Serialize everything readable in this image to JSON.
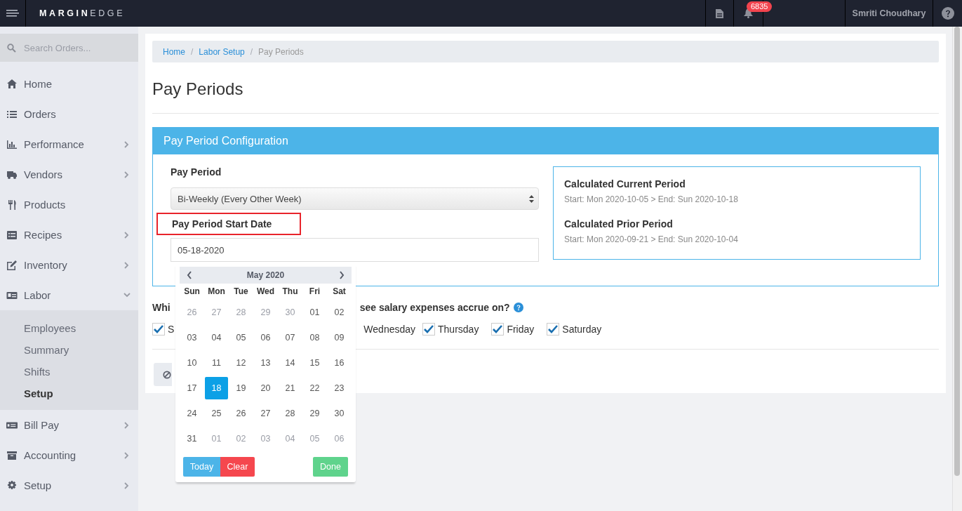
{
  "topbar": {
    "logo_strong": "MARGIN",
    "logo_light": "EDGE",
    "notification_count": "6835",
    "user": "Smriti Choudhary"
  },
  "sidebar": {
    "search": {
      "placeholder": "Search Orders..."
    },
    "items": [
      {
        "kind": "home",
        "label": "Home",
        "arrow": false
      },
      {
        "kind": "list",
        "label": "Orders",
        "arrow": false
      },
      {
        "kind": "chart",
        "label": "Performance",
        "arrow": true
      },
      {
        "kind": "truck",
        "label": "Vendors",
        "arrow": true
      },
      {
        "kind": "utensils",
        "label": "Products",
        "arrow": false
      },
      {
        "kind": "book",
        "label": "Recipes",
        "arrow": true
      },
      {
        "kind": "edit",
        "label": "Inventory",
        "arrow": true
      },
      {
        "kind": "card",
        "label": "Labor",
        "arrow": true,
        "expanded": true,
        "children": [
          {
            "label": "Employees",
            "selected": false
          },
          {
            "label": "Summary",
            "selected": false
          },
          {
            "label": "Shifts",
            "selected": false
          },
          {
            "label": "Setup",
            "selected": true
          }
        ]
      },
      {
        "kind": "bill",
        "label": "Bill Pay",
        "arrow": true
      },
      {
        "kind": "archive",
        "label": "Accounting",
        "arrow": true
      },
      {
        "kind": "gear",
        "label": "Setup",
        "arrow": true
      }
    ]
  },
  "breadcrumb": [
    {
      "label": "Home",
      "link": true
    },
    {
      "separator": "/",
      "label": "Labor Setup",
      "link": true
    },
    {
      "separator": "/",
      "label": "Pay Periods",
      "link": false
    }
  ],
  "title": "Pay Periods",
  "config": {
    "header": "Pay Period Configuration",
    "pay_period": {
      "label": "Pay Period",
      "value": "Bi-Weekly (Every Other Week)"
    },
    "start_date": {
      "label": "Pay Period Start Date",
      "highlighted": true,
      "value": "05-18-2020"
    },
    "summary": [
      {
        "heading": "Calculated Current Period",
        "text": "Start: Mon 2020-10-05 > End: Sun 2020-10-18"
      },
      {
        "heading": "Calculated Prior Period",
        "text": "Start: Mon 2020-09-21 > End: Sun 2020-10-04"
      }
    ]
  },
  "accrual": {
    "question_start": "Whi",
    "question_end": "see salary expenses accrue on?",
    "days": [
      {
        "label": "S",
        "checked": true
      },
      {
        "label": "Wednesday"
      },
      {
        "label": "Thursday",
        "checked": true
      },
      {
        "label": "Friday",
        "checked": true
      },
      {
        "label": "Saturday",
        "checked": true
      }
    ]
  },
  "datepicker": {
    "month": "May 2020",
    "weekdays": [
      "Sun",
      "Mon",
      "Tue",
      "Wed",
      "Thu",
      "Fri",
      "Sat"
    ],
    "weeks": [
      [
        {
          "day": "26",
          "muted": true
        },
        {
          "day": "27",
          "muted": true
        },
        {
          "day": "28",
          "muted": true
        },
        {
          "day": "29",
          "muted": true
        },
        {
          "day": "30",
          "muted": true
        },
        {
          "day": "01",
          "muted": false
        },
        {
          "day": "02",
          "muted": false
        }
      ],
      [
        {
          "day": "03",
          "muted": false
        },
        {
          "day": "04",
          "muted": false
        },
        {
          "day": "05",
          "muted": false
        },
        {
          "day": "06",
          "muted": false
        },
        {
          "day": "07",
          "muted": false
        },
        {
          "day": "08",
          "muted": false
        },
        {
          "day": "09",
          "muted": false
        }
      ],
      [
        {
          "day": "10",
          "muted": false
        },
        {
          "day": "11",
          "muted": false
        },
        {
          "day": "12",
          "muted": false
        },
        {
          "day": "13",
          "muted": false
        },
        {
          "day": "14",
          "muted": false
        },
        {
          "day": "15",
          "muted": false
        },
        {
          "day": "16",
          "muted": false
        }
      ],
      [
        {
          "day": "17",
          "muted": false
        },
        {
          "day": "18",
          "muted": false,
          "selected": true
        },
        {
          "day": "19",
          "muted": false
        },
        {
          "day": "20",
          "muted": false
        },
        {
          "day": "21",
          "muted": false
        },
        {
          "day": "22",
          "muted": false
        },
        {
          "day": "23",
          "muted": false
        }
      ],
      [
        {
          "day": "24",
          "muted": false
        },
        {
          "day": "25",
          "muted": false
        },
        {
          "day": "26",
          "muted": false
        },
        {
          "day": "27",
          "muted": false
        },
        {
          "day": "28",
          "muted": false
        },
        {
          "day": "29",
          "muted": false
        },
        {
          "day": "30",
          "muted": false
        }
      ],
      [
        {
          "day": "31",
          "muted": false
        },
        {
          "day": "01",
          "muted": true
        },
        {
          "day": "02",
          "muted": true
        },
        {
          "day": "03",
          "muted": true
        },
        {
          "day": "04",
          "muted": true
        },
        {
          "day": "05",
          "muted": true
        },
        {
          "day": "06",
          "muted": true
        }
      ]
    ],
    "buttons": [
      {
        "kind": "today",
        "label": "Today"
      },
      {
        "kind": "clear",
        "label": "Clear"
      },
      {
        "kind": "done",
        "label": "Done"
      }
    ]
  }
}
